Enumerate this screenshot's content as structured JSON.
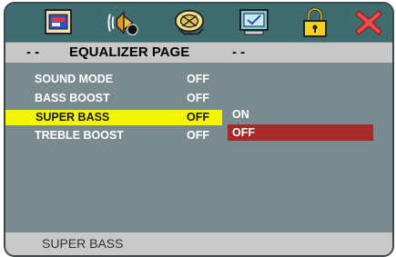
{
  "tabs": [
    {
      "icon": "general-setup-icon"
    },
    {
      "icon": "speaker-setup-icon"
    },
    {
      "icon": "audio-setup-icon"
    },
    {
      "icon": "video-setup-icon"
    },
    {
      "icon": "lock-icon"
    },
    {
      "icon": "close-icon"
    }
  ],
  "page": {
    "dashes_left": "- -",
    "title": "EQUALIZER PAGE",
    "dashes_right": "- -"
  },
  "menu": [
    {
      "label": "SOUND MODE",
      "value": "OFF"
    },
    {
      "label": "BASS BOOST",
      "value": "OFF"
    },
    {
      "label": "SUPER BASS",
      "value": "OFF",
      "highlighted": true
    },
    {
      "label": "TREBLE BOOST",
      "value": "OFF"
    }
  ],
  "options": [
    {
      "label": "ON"
    },
    {
      "label": "OFF",
      "selected": true
    }
  ],
  "status": {
    "text": "SUPER BASS"
  },
  "colors": {
    "icon_bar": "#3f6c6e",
    "panel": "#7a8b90",
    "highlight": "#f4f404",
    "selected_option": "#a72a2a"
  }
}
